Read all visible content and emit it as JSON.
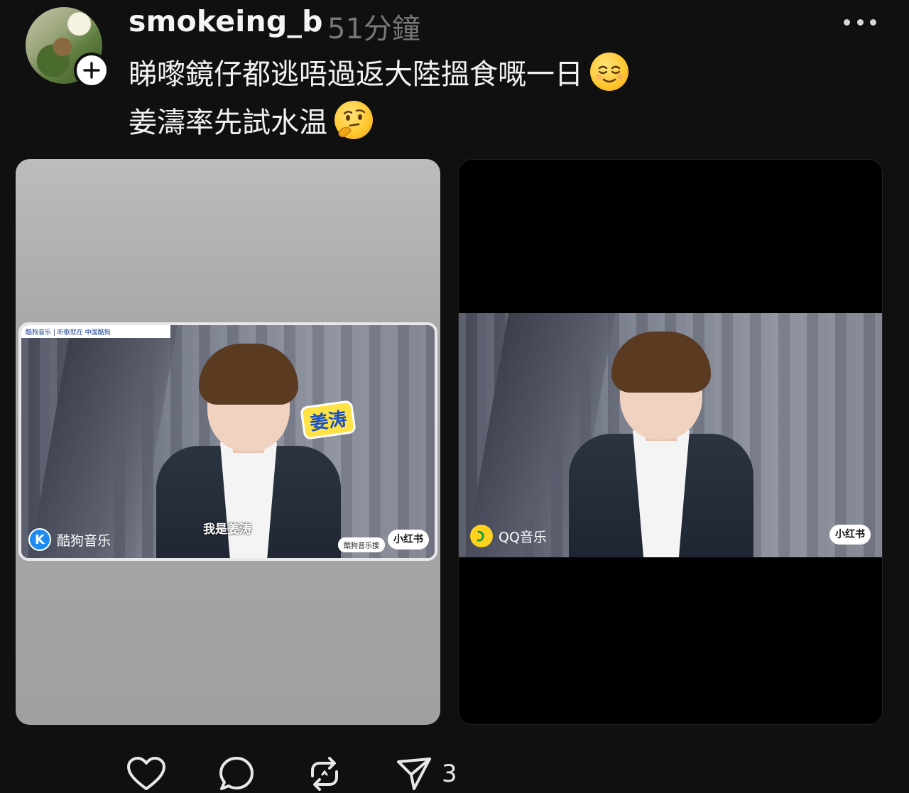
{
  "post": {
    "username": "smokeing_b",
    "timestamp": "51分鐘",
    "caption_line1": "睇嚟鏡仔都逃唔過返大陸搵食嘅一日",
    "caption_line2": "姜濤率先試水温",
    "emoji_line1": "relieved-face-emoji",
    "emoji_line2": "thinking-face-emoji"
  },
  "media": {
    "left": {
      "brand_label": "酷狗音乐",
      "brand_letter": "K",
      "subtitle": "我是姜涛",
      "sticker": "姜涛",
      "watermark": "小红书",
      "search_label": "酷狗音乐搜",
      "top_strip": "酷狗音乐 | 听歌就在 中国酷狗"
    },
    "right": {
      "brand_label": "QQ音乐",
      "watermark": "小红书"
    }
  },
  "actions": {
    "share_count": "3"
  },
  "colors": {
    "background": "#101010",
    "timestamp": "#777777",
    "text": "#f2f2f2"
  }
}
